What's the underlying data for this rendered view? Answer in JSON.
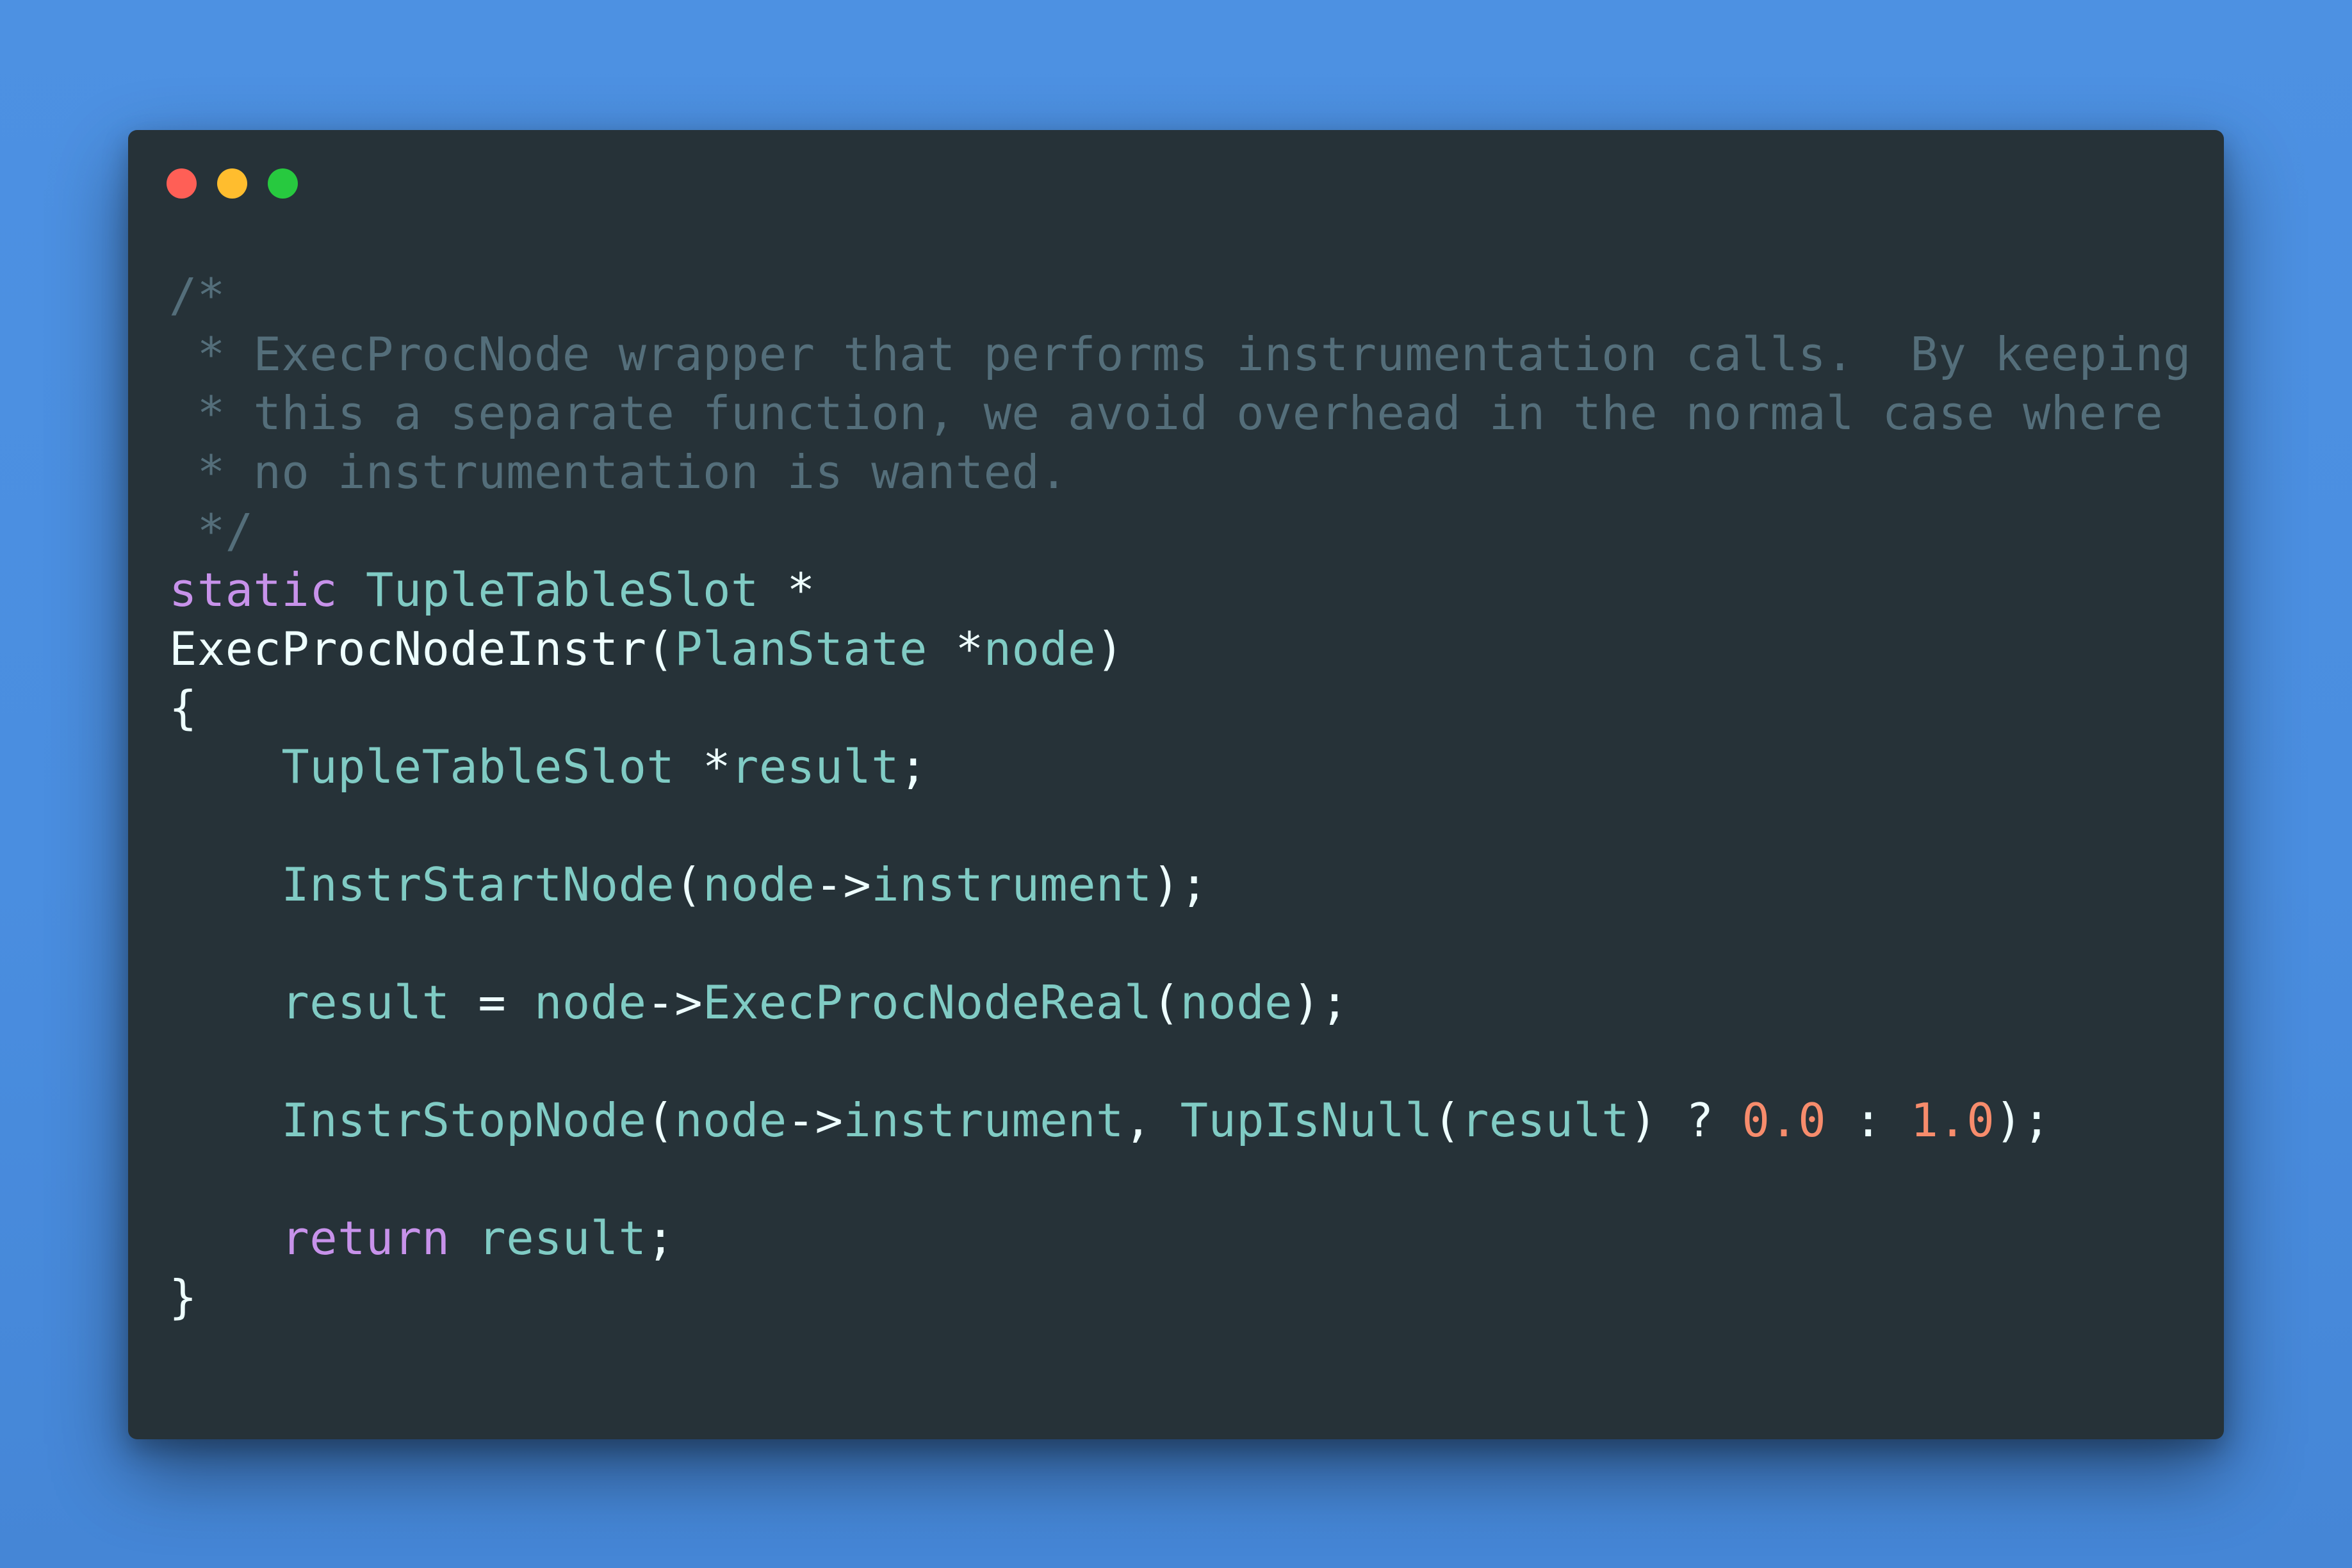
{
  "window": {
    "controls": [
      "close",
      "minimize",
      "maximize"
    ],
    "colors": {
      "background": "#263238",
      "close": "#ff5f56",
      "minimize": "#ffbd2e",
      "maximize": "#27c93f",
      "page_background": "#4a8fe0"
    }
  },
  "code": {
    "language": "c",
    "lines": [
      [
        {
          "t": "/*",
          "c": "cm"
        }
      ],
      [
        {
          "t": " * ExecProcNode wrapper that performs instrumentation calls.  By keeping",
          "c": "cm"
        }
      ],
      [
        {
          "t": " * this a separate function, we avoid overhead in the normal case where",
          "c": "cm"
        }
      ],
      [
        {
          "t": " * no instrumentation is wanted.",
          "c": "cm"
        }
      ],
      [
        {
          "t": " */",
          "c": "cm"
        }
      ],
      [
        {
          "t": "static",
          "c": "kw"
        },
        {
          "t": " ",
          "c": "pl"
        },
        {
          "t": "TupleTableSlot",
          "c": "ty"
        },
        {
          "t": " *",
          "c": "pl"
        }
      ],
      [
        {
          "t": "ExecProcNodeInstr(",
          "c": "pl"
        },
        {
          "t": "PlanState",
          "c": "ty"
        },
        {
          "t": " *",
          "c": "pl"
        },
        {
          "t": "node",
          "c": "id"
        },
        {
          "t": ")",
          "c": "pl"
        }
      ],
      [
        {
          "t": "{",
          "c": "pl"
        }
      ],
      [
        {
          "t": "    ",
          "c": "pl"
        },
        {
          "t": "TupleTableSlot",
          "c": "ty"
        },
        {
          "t": " *",
          "c": "pl"
        },
        {
          "t": "result",
          "c": "id"
        },
        {
          "t": ";",
          "c": "pl"
        }
      ],
      [
        {
          "t": "",
          "c": "pl"
        }
      ],
      [
        {
          "t": "    ",
          "c": "pl"
        },
        {
          "t": "InstrStartNode",
          "c": "fn"
        },
        {
          "t": "(",
          "c": "pl"
        },
        {
          "t": "node",
          "c": "id"
        },
        {
          "t": "->",
          "c": "pl"
        },
        {
          "t": "instrument",
          "c": "id"
        },
        {
          "t": ");",
          "c": "pl"
        }
      ],
      [
        {
          "t": "",
          "c": "pl"
        }
      ],
      [
        {
          "t": "    ",
          "c": "pl"
        },
        {
          "t": "result",
          "c": "id"
        },
        {
          "t": " = ",
          "c": "pl"
        },
        {
          "t": "node",
          "c": "id"
        },
        {
          "t": "->",
          "c": "pl"
        },
        {
          "t": "ExecProcNodeReal",
          "c": "fn"
        },
        {
          "t": "(",
          "c": "pl"
        },
        {
          "t": "node",
          "c": "id"
        },
        {
          "t": ");",
          "c": "pl"
        }
      ],
      [
        {
          "t": "",
          "c": "pl"
        }
      ],
      [
        {
          "t": "    ",
          "c": "pl"
        },
        {
          "t": "InstrStopNode",
          "c": "fn"
        },
        {
          "t": "(",
          "c": "pl"
        },
        {
          "t": "node",
          "c": "id"
        },
        {
          "t": "->",
          "c": "pl"
        },
        {
          "t": "instrument",
          "c": "id"
        },
        {
          "t": ", ",
          "c": "pl"
        },
        {
          "t": "TupIsNull",
          "c": "fn"
        },
        {
          "t": "(",
          "c": "pl"
        },
        {
          "t": "result",
          "c": "id"
        },
        {
          "t": ") ? ",
          "c": "pl"
        },
        {
          "t": "0.0",
          "c": "nm"
        },
        {
          "t": " : ",
          "c": "pl"
        },
        {
          "t": "1.0",
          "c": "nm"
        },
        {
          "t": ");",
          "c": "pl"
        }
      ],
      [
        {
          "t": "",
          "c": "pl"
        }
      ],
      [
        {
          "t": "    ",
          "c": "pl"
        },
        {
          "t": "return",
          "c": "kw"
        },
        {
          "t": " ",
          "c": "pl"
        },
        {
          "t": "result",
          "c": "id"
        },
        {
          "t": ";",
          "c": "pl"
        }
      ],
      [
        {
          "t": "}",
          "c": "pl"
        }
      ]
    ]
  }
}
